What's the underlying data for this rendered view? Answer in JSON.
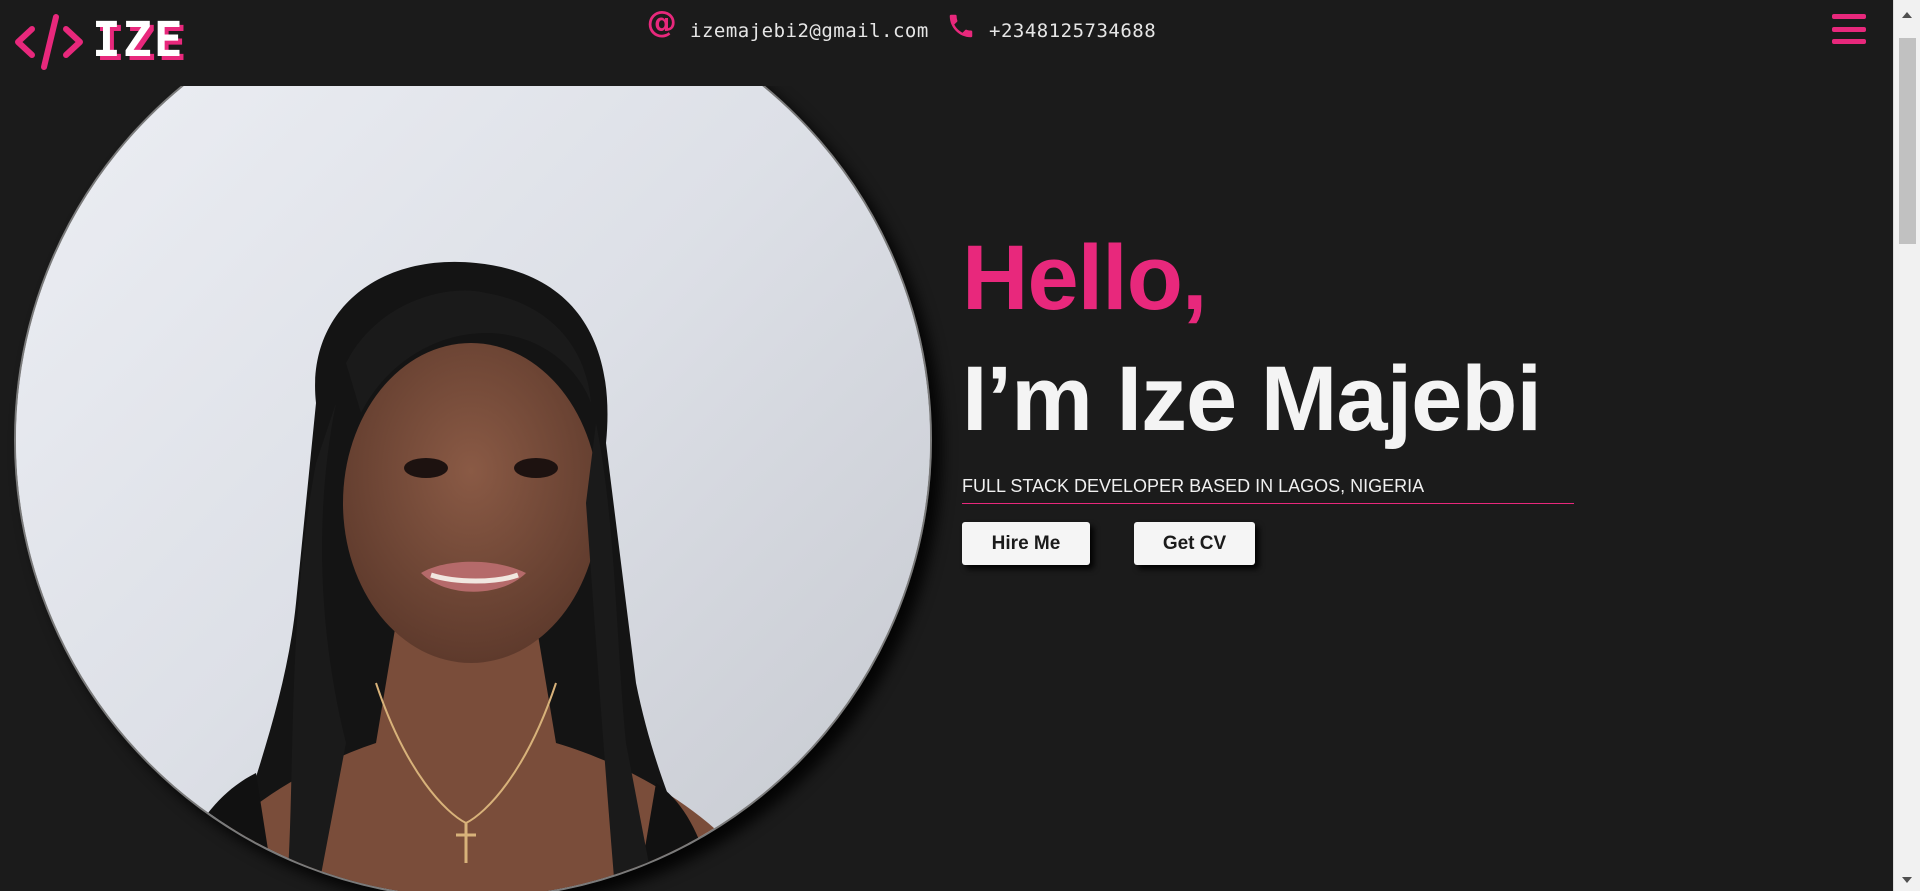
{
  "header": {
    "logo_text": "IZE",
    "email": "izemajebi2@gmail.com",
    "phone": "+2348125734688",
    "email_icon": "at-sign-icon",
    "phone_icon": "phone-icon",
    "menu_icon": "hamburger-menu-icon"
  },
  "hero": {
    "greeting": "Hello,",
    "name": "I’m Ize Majebi",
    "tagline": "FULL STACK DEVELOPER BASED IN LAGOS, NIGERIA",
    "buttons": {
      "hire_label": "Hire Me",
      "cv_label": "Get CV"
    },
    "photo": "profile-photo"
  },
  "colors": {
    "background": "#1b1b1b",
    "accent": "#e8287c",
    "text": "#f4f4f4",
    "button_bg": "#f5f5f5"
  }
}
